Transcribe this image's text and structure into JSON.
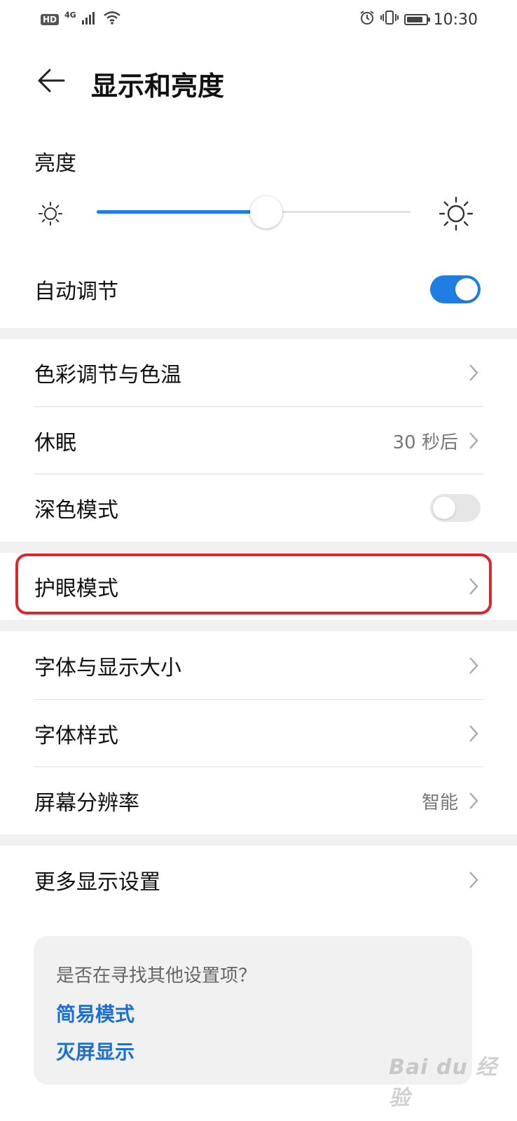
{
  "status_bar": {
    "hd": "HD",
    "network": "4G",
    "time": "10:30",
    "battery_level": 0.85
  },
  "header": {
    "title": "显示和亮度"
  },
  "brightness": {
    "label": "亮度",
    "level": 0.54
  },
  "auto_adjust": {
    "label": "自动调节",
    "enabled": true
  },
  "rows": {
    "color": {
      "label": "色彩调节与色温"
    },
    "sleep": {
      "label": "休眠",
      "value": "30 秒后"
    },
    "dark": {
      "label": "深色模式",
      "enabled": false
    },
    "eye": {
      "label": "护眼模式"
    },
    "font_size": {
      "label": "字体与显示大小"
    },
    "font_style": {
      "label": "字体样式"
    },
    "resolution": {
      "label": "屏幕分辨率",
      "value": "智能"
    },
    "more": {
      "label": "更多显示设置"
    }
  },
  "suggestions": {
    "title": "是否在寻找其他设置项？",
    "links": [
      "简易模式",
      "灭屏显示"
    ]
  },
  "watermark": "Bai du 经验",
  "colors": {
    "accent": "#1e7ee4",
    "highlight": "#d9262f",
    "link": "#1a6fd6"
  }
}
